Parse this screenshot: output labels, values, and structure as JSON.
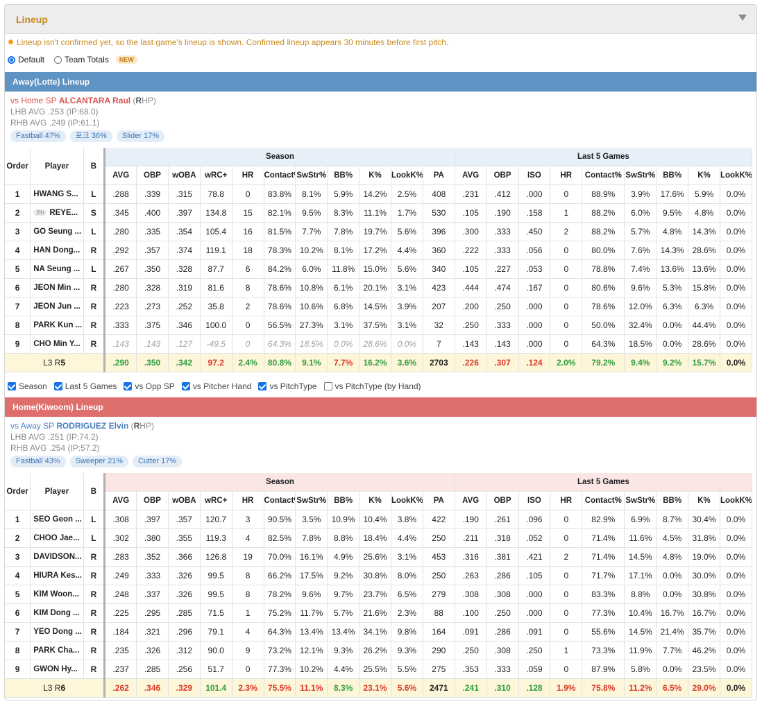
{
  "panel": {
    "title": "Lineup"
  },
  "notice": "Lineup isn't confirmed yet, so the last game's lineup is shown. Confirmed lineup appears 30 minutes before first pitch.",
  "view_options": [
    {
      "label": "Default",
      "selected": true
    },
    {
      "label": "Team Totals",
      "selected": false,
      "badge": "NEW"
    }
  ],
  "columns": {
    "order": "Order",
    "player": "Player",
    "bats": "B",
    "season_group": "Season",
    "last5_group": "Last 5 Games",
    "season": [
      "AVG",
      "OBP",
      "wOBA",
      "wRC+",
      "HR",
      "Contact%",
      "SwStr%",
      "BB%",
      "K%",
      "LookK%",
      "PA"
    ],
    "last5": [
      "AVG",
      "OBP",
      "ISO",
      "HR",
      "Contact%",
      "SwStr%",
      "BB%",
      "K%",
      "LookK%"
    ]
  },
  "away": {
    "header": "Away(Lotte) Lineup",
    "header_color": "#5f93c3",
    "sp_prefix": "vs Home SP",
    "sp_name": "ALCANTARA Raul",
    "sp_hand_open": "(",
    "sp_hand_letter": "R",
    "sp_hand_rest": "HP)",
    "lhb": "LHB AVG .253 (IP:68.0)",
    "rhb": "RHB AVG .249 (IP:61.1)",
    "pitches": [
      "Fastball 47%",
      "포크 36%",
      "Slider 17%"
    ],
    "rows": [
      {
        "order": "1",
        "player": "HWANG S...",
        "b": "L",
        "season": [
          ".288",
          ".339",
          ".315",
          "78.8",
          "0",
          "83.8%",
          "8.1%",
          "5.9%",
          "14.2%",
          "2.5%",
          "408"
        ],
        "last5": [
          ".231",
          ".412",
          ".000",
          "0",
          "88.9%",
          "3.9%",
          "17.6%",
          "5.9%",
          "0.0%"
        ]
      },
      {
        "order": "2",
        "badge": "2th",
        "player": "REYE...",
        "b": "S",
        "season": [
          ".345",
          ".400",
          ".397",
          "134.8",
          "15",
          "82.1%",
          "9.5%",
          "8.3%",
          "11.1%",
          "1.7%",
          "530"
        ],
        "last5": [
          ".105",
          ".190",
          ".158",
          "1",
          "88.2%",
          "6.0%",
          "9.5%",
          "4.8%",
          "0.0%"
        ]
      },
      {
        "order": "3",
        "player": "GO Seung ...",
        "b": "L",
        "season": [
          ".280",
          ".335",
          ".354",
          "105.4",
          "16",
          "81.5%",
          "7.7%",
          "7.8%",
          "19.7%",
          "5.6%",
          "396"
        ],
        "last5": [
          ".300",
          ".333",
          ".450",
          "2",
          "88.2%",
          "5.7%",
          "4.8%",
          "14.3%",
          "0.0%"
        ]
      },
      {
        "order": "4",
        "player": "HAN Dong...",
        "b": "R",
        "season": [
          ".292",
          ".357",
          ".374",
          "119.1",
          "18",
          "78.3%",
          "10.2%",
          "8.1%",
          "17.2%",
          "4.4%",
          "360"
        ],
        "last5": [
          ".222",
          ".333",
          ".056",
          "0",
          "80.0%",
          "7.6%",
          "14.3%",
          "28.6%",
          "0.0%"
        ]
      },
      {
        "order": "5",
        "player": "NA Seung ...",
        "b": "L",
        "season": [
          ".267",
          ".350",
          ".328",
          "87.7",
          "6",
          "84.2%",
          "6.0%",
          "11.8%",
          "15.0%",
          "5.6%",
          "340"
        ],
        "last5": [
          ".105",
          ".227",
          ".053",
          "0",
          "78.8%",
          "7.4%",
          "13.6%",
          "13.6%",
          "0.0%"
        ]
      },
      {
        "order": "6",
        "player": "JEON Min ...",
        "b": "R",
        "season": [
          ".280",
          ".328",
          ".319",
          "81.6",
          "8",
          "78.6%",
          "10.8%",
          "6.1%",
          "20.1%",
          "3.1%",
          "423"
        ],
        "last5": [
          ".444",
          ".474",
          ".167",
          "0",
          "80.6%",
          "9.6%",
          "5.3%",
          "15.8%",
          "0.0%"
        ]
      },
      {
        "order": "7",
        "player": "JEON Jun ...",
        "b": "R",
        "season": [
          ".223",
          ".273",
          ".252",
          "35.8",
          "2",
          "78.6%",
          "10.6%",
          "6.8%",
          "14.5%",
          "3.9%",
          "207"
        ],
        "last5": [
          ".200",
          ".250",
          ".000",
          "0",
          "78.6%",
          "12.0%",
          "6.3%",
          "6.3%",
          "0.0%"
        ]
      },
      {
        "order": "8",
        "player": "PARK Kun ...",
        "b": "R",
        "season": [
          ".333",
          ".375",
          ".346",
          "100.0",
          "0",
          "56.5%",
          "27.3%",
          "3.1%",
          "37.5%",
          "3.1%",
          "32"
        ],
        "last5": [
          ".250",
          ".333",
          ".000",
          "0",
          "50.0%",
          "32.4%",
          "0.0%",
          "44.4%",
          "0.0%"
        ]
      },
      {
        "order": "9",
        "player": "CHO Min Y...",
        "b": "R",
        "muted_season": true,
        "season": [
          ".143",
          ".143",
          ".127",
          "-49.5",
          "0",
          "64.3%",
          "18.5%",
          "0.0%",
          "28.6%",
          "0.0%",
          "7"
        ],
        "last5": [
          ".143",
          ".143",
          ".000",
          "0",
          "64.3%",
          "18.5%",
          "0.0%",
          "28.6%",
          "0.0%"
        ]
      }
    ],
    "summary": {
      "label_prefix": "L3 R",
      "label_num": "5",
      "season": [
        ".290",
        ".350",
        ".342",
        "97.2",
        "2.4%",
        "80.8%",
        "9.1%",
        "7.7%",
        "16.2%",
        "3.6%",
        "2703"
      ],
      "season_colors": [
        "g",
        "g",
        "g",
        "r",
        "g",
        "g",
        "g",
        "r",
        "g",
        "g",
        ""
      ],
      "last5": [
        ".226",
        ".307",
        ".124",
        "2.0%",
        "79.2%",
        "9.4%",
        "9.2%",
        "15.7%",
        "0.0%"
      ],
      "last5_colors": [
        "r",
        "r",
        "r",
        "g",
        "g",
        "g",
        "g",
        "g",
        ""
      ]
    }
  },
  "filters": [
    {
      "label": "Season",
      "checked": true
    },
    {
      "label": "Last 5 Games",
      "checked": true
    },
    {
      "label": "vs Opp SP",
      "checked": true
    },
    {
      "label": "vs Pitcher Hand",
      "checked": true
    },
    {
      "label": "vs PitchType",
      "checked": true
    },
    {
      "label": "vs PitchType (by Hand)",
      "checked": false
    }
  ],
  "home": {
    "header": "Home(Kiwoom) Lineup",
    "header_color": "#df6f6c",
    "sp_prefix": "vs Away SP",
    "sp_name": "RODRIGUEZ Elvin",
    "sp_hand_open": "(",
    "sp_hand_letter": "R",
    "sp_hand_rest": "HP)",
    "lhb": "LHB AVG .251 (IP:74.2)",
    "rhb": "RHB AVG .254 (IP:57.2)",
    "pitches": [
      "Fastball 43%",
      "Sweeper 21%",
      "Cutter 17%"
    ],
    "rows": [
      {
        "order": "1",
        "player": "SEO Geon ...",
        "b": "L",
        "season": [
          ".308",
          ".397",
          ".357",
          "120.7",
          "3",
          "90.5%",
          "3.5%",
          "10.9%",
          "10.4%",
          "3.8%",
          "422"
        ],
        "last5": [
          ".190",
          ".261",
          ".096",
          "0",
          "82.9%",
          "6.9%",
          "8.7%",
          "30.4%",
          "0.0%"
        ]
      },
      {
        "order": "2",
        "player": "CHOO Jae...",
        "b": "L",
        "season": [
          ".302",
          ".380",
          ".355",
          "119.3",
          "4",
          "82.5%",
          "7.8%",
          "8.8%",
          "18.4%",
          "4.4%",
          "250"
        ],
        "last5": [
          ".211",
          ".318",
          ".052",
          "0",
          "71.4%",
          "11.6%",
          "4.5%",
          "31.8%",
          "0.0%"
        ]
      },
      {
        "order": "3",
        "player": "DAVIDSON...",
        "b": "R",
        "season": [
          ".283",
          ".352",
          ".366",
          "126.8",
          "19",
          "70.0%",
          "16.1%",
          "4.9%",
          "25.6%",
          "3.1%",
          "453"
        ],
        "last5": [
          ".316",
          ".381",
          ".421",
          "2",
          "71.4%",
          "14.5%",
          "4.8%",
          "19.0%",
          "0.0%"
        ]
      },
      {
        "order": "4",
        "player": "HIURA Kes...",
        "b": "R",
        "season": [
          ".249",
          ".333",
          ".326",
          "99.5",
          "8",
          "66.2%",
          "17.5%",
          "9.2%",
          "30.8%",
          "8.0%",
          "250"
        ],
        "last5": [
          ".263",
          ".286",
          ".105",
          "0",
          "71.7%",
          "17.1%",
          "0.0%",
          "30.0%",
          "0.0%"
        ]
      },
      {
        "order": "5",
        "player": "KIM Woon...",
        "b": "R",
        "season": [
          ".248",
          ".337",
          ".326",
          "99.5",
          "8",
          "78.2%",
          "9.6%",
          "9.7%",
          "23.7%",
          "6.5%",
          "279"
        ],
        "last5": [
          ".308",
          ".308",
          ".000",
          "0",
          "83.3%",
          "8.8%",
          "0.0%",
          "30.8%",
          "0.0%"
        ]
      },
      {
        "order": "6",
        "player": "KIM Dong ...",
        "b": "R",
        "season": [
          ".225",
          ".295",
          ".285",
          "71.5",
          "1",
          "75.2%",
          "11.7%",
          "5.7%",
          "21.6%",
          "2.3%",
          "88"
        ],
        "last5": [
          ".100",
          ".250",
          ".000",
          "0",
          "77.3%",
          "10.4%",
          "16.7%",
          "16.7%",
          "0.0%"
        ]
      },
      {
        "order": "7",
        "player": "YEO Dong ...",
        "b": "R",
        "season": [
          ".184",
          ".321",
          ".296",
          "79.1",
          "4",
          "64.3%",
          "13.4%",
          "13.4%",
          "34.1%",
          "9.8%",
          "164"
        ],
        "last5": [
          ".091",
          ".286",
          ".091",
          "0",
          "55.6%",
          "14.5%",
          "21.4%",
          "35.7%",
          "0.0%"
        ]
      },
      {
        "order": "8",
        "player": "PARK Cha...",
        "b": "R",
        "season": [
          ".235",
          ".326",
          ".312",
          "90.0",
          "9",
          "73.2%",
          "12.1%",
          "9.3%",
          "26.2%",
          "9.3%",
          "290"
        ],
        "last5": [
          ".250",
          ".308",
          ".250",
          "1",
          "73.3%",
          "11.9%",
          "7.7%",
          "46.2%",
          "0.0%"
        ]
      },
      {
        "order": "9",
        "player": "GWON Hy...",
        "b": "R",
        "season": [
          ".237",
          ".285",
          ".256",
          "51.7",
          "0",
          "77.3%",
          "10.2%",
          "4.4%",
          "25.5%",
          "5.5%",
          "275"
        ],
        "last5": [
          ".353",
          ".333",
          ".059",
          "0",
          "87.9%",
          "5.8%",
          "0.0%",
          "23.5%",
          "0.0%"
        ]
      }
    ],
    "summary": {
      "label_prefix": "L3 R",
      "label_num": "6",
      "season": [
        ".262",
        ".346",
        ".329",
        "101.4",
        "2.3%",
        "75.5%",
        "11.1%",
        "8.3%",
        "23.1%",
        "5.6%",
        "2471"
      ],
      "season_colors": [
        "r",
        "r",
        "r",
        "g",
        "r",
        "r",
        "r",
        "g",
        "r",
        "r",
        ""
      ],
      "last5": [
        ".241",
        ".310",
        ".128",
        "1.9%",
        "75.8%",
        "11.2%",
        "6.5%",
        "29.0%",
        "0.0%"
      ],
      "last5_colors": [
        "g",
        "g",
        "g",
        "r",
        "r",
        "r",
        "r",
        "r",
        ""
      ]
    }
  },
  "colors": {
    "away_table_head": "#e7f0f8",
    "home_table_head": "#fbe6e6",
    "away_sp_name": "#d9534f",
    "home_sp_name": "#4a7fc0",
    "summary_bg": "#fdf6d9"
  }
}
